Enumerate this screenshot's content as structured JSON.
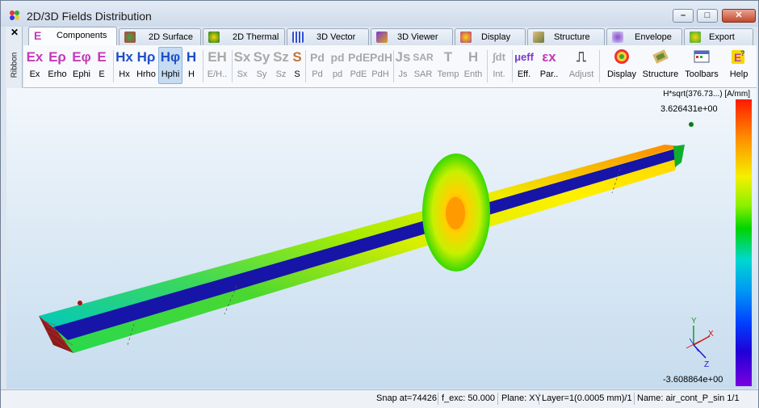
{
  "window": {
    "title": "2D/3D Fields Distribution"
  },
  "ribbon": {
    "close_glyph": "✕",
    "label": "Ribbon"
  },
  "tabs": [
    {
      "label": "Components",
      "icon": "components-icon",
      "color": "#c23bb8",
      "active": true
    },
    {
      "label": "2D Surface",
      "icon": "surface-icon",
      "color": "#3aa845"
    },
    {
      "label": "2D Thermal",
      "icon": "thermal-icon",
      "color": "#1c7c2c"
    },
    {
      "label": "3D Vector",
      "icon": "vector-icon",
      "color": "#2f4fd0"
    },
    {
      "label": "3D Viewer",
      "icon": "viewer-icon",
      "color": "#7a3ad0"
    },
    {
      "label": "Display",
      "icon": "display-icon",
      "color": "#c03a8a"
    },
    {
      "label": "Structure",
      "icon": "structure-icon",
      "color": "#9a6a2a"
    },
    {
      "label": "Envelope",
      "icon": "envelope-icon",
      "color": "#8a4ad0"
    },
    {
      "label": "Export",
      "icon": "export-icon",
      "color": "#3aa845"
    }
  ],
  "toolbar": {
    "e_group": [
      {
        "glyph": "Ex",
        "label": "Ex"
      },
      {
        "glyph": "Eρ",
        "label": "Erho"
      },
      {
        "glyph": "Eφ",
        "label": "Ephi"
      },
      {
        "glyph": "E",
        "label": "E"
      }
    ],
    "h_group": [
      {
        "glyph": "Hx",
        "label": "Hx"
      },
      {
        "glyph": "Hρ",
        "label": "Hrho"
      },
      {
        "glyph": "Hφ",
        "label": "Hphi",
        "selected": true
      },
      {
        "glyph": "H",
        "label": "H"
      }
    ],
    "eh": {
      "glyph": "EH",
      "label": "E/H.."
    },
    "s_group": [
      {
        "glyph": "Sx",
        "label": "Sx"
      },
      {
        "glyph": "Sy",
        "label": "Sy"
      },
      {
        "glyph": "Sz",
        "label": "Sz"
      },
      {
        "glyph": "S",
        "label": "S"
      }
    ],
    "p_group": [
      {
        "glyph": "Pd",
        "label": "Pd"
      },
      {
        "glyph": "pd",
        "label": "pd"
      },
      {
        "glyph": "PdE",
        "label": "PdE"
      },
      {
        "glyph": "PdH",
        "label": "PdH"
      }
    ],
    "misc_group": [
      {
        "glyph": "Js",
        "label": "Js"
      },
      {
        "glyph": "SAR",
        "label": "SAR"
      },
      {
        "glyph": "T",
        "label": "Temp"
      },
      {
        "glyph": "H",
        "label": "Enth"
      }
    ],
    "int": {
      "glyph": "∫dt",
      "label": "Int."
    },
    "eff": {
      "glyph": "μeff",
      "label": "Eff."
    },
    "par": {
      "glyph": "εx",
      "label": "Par.."
    },
    "adjust": {
      "glyph": "⎍",
      "label": "Adjust"
    },
    "right_group": [
      {
        "label": "Display",
        "icon": "display-icon"
      },
      {
        "label": "Structure",
        "icon": "structure-icon"
      },
      {
        "label": "Toolbars",
        "icon": "toolbars-icon"
      },
      {
        "label": "Help",
        "icon": "help-icon"
      }
    ]
  },
  "colorbar": {
    "title": "H*sqrt(376.73...) [A/mm]",
    "max": "3.626431e+00",
    "min": "-3.608864e+00"
  },
  "axes": {
    "x": "X",
    "y": "Y",
    "z": "Z"
  },
  "status": {
    "snap": "Snap at=74426",
    "fexc": "f_exc: 50.000",
    "plane": "Plane: XY",
    "layer": "Layer=1(0.0005 mm)/1",
    "name": "Name: air_cont_P_sin 1/1"
  },
  "colors": {
    "accent_e": "#c23bb8",
    "accent_h": "#1e4fc9",
    "selected_bg": "#c6dcf3"
  }
}
